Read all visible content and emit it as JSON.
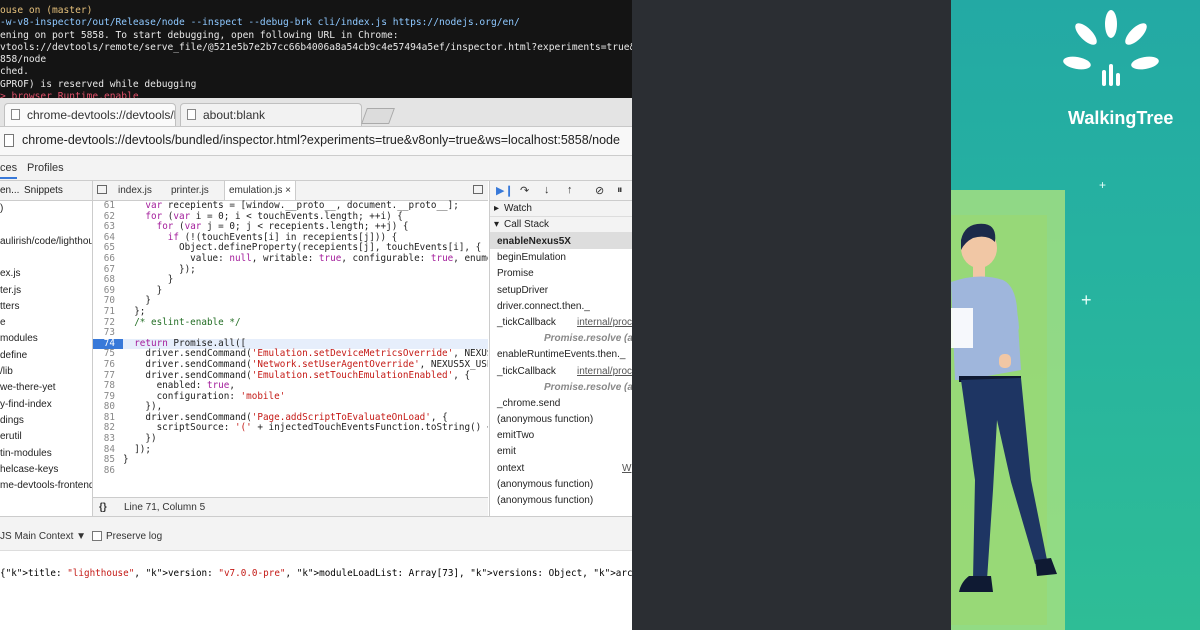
{
  "terminal": {
    "lines": [
      {
        "text": "ouse on (master)",
        "tone": "yellow"
      },
      {
        "text": "-w-v8-inspector/out/Release/node --inspect --debug-brk cli/index.js https://nodejs.org/en/",
        "tone": "cyan"
      },
      {
        "text": "ening on port 5858. To start debugging, open following URL in Chrome:",
        "tone": "plain"
      },
      {
        "text": "vtools://devtools/remote/serve_file/@521e5b7e2b7cc66b4006a8a54cb9c4e57494a5ef/inspector.html?experiments=true&",
        "tone": "plain"
      },
      {
        "text": "858/node",
        "tone": "plain"
      },
      {
        "text": "ched.",
        "tone": "plain"
      },
      {
        "text": "GPROF) is reserved while debugging",
        "tone": "plain"
      },
      {
        "text": "> browser Runtime.enable",
        "tone": "red"
      }
    ]
  },
  "browser": {
    "tabs": [
      {
        "label": "chrome-devtools://devtools/bu"
      },
      {
        "label": "about:blank"
      }
    ],
    "url": "chrome-devtools://devtools/bundled/inspector.html?experiments=true&v8only=true&ws=localhost:5858/node"
  },
  "devtools": {
    "panel_tabs": [
      "ces",
      "Profiles"
    ],
    "navigator_tabs": [
      "en...",
      "Snippets"
    ],
    "navigator_items": [
      ")",
      "",
      "aulirish/code/lighthous",
      "",
      "ex.js",
      "ter.js",
      "tters",
      "e",
      "modules",
      "define",
      "/lib",
      "we-there-yet",
      "y-find-index",
      "dings",
      "erutil",
      "tin-modules",
      "helcase-keys",
      "me-devtools-frontend"
    ],
    "file_tabs": [
      "index.js",
      "printer.js",
      "emulation.js ×"
    ],
    "code": [
      {
        "n": "61",
        "text": "    var recepients = [window.__proto__, document.__proto__];"
      },
      {
        "n": "62",
        "text": "    for (var i = 0; i < touchEvents.length; ++i) {"
      },
      {
        "n": "63",
        "text": "      for (var j = 0; j < recepients.length; ++j) {"
      },
      {
        "n": "64",
        "text": "        if (!(touchEvents[i] in recepients[j])) {"
      },
      {
        "n": "65",
        "text": "          Object.defineProperty(recepients[j], touchEvents[i], {"
      },
      {
        "n": "66",
        "text": "            value: null, writable: true, configurable: true, enumera"
      },
      {
        "n": "67",
        "text": "          });"
      },
      {
        "n": "68",
        "text": "        }"
      },
      {
        "n": "69",
        "text": "      }"
      },
      {
        "n": "70",
        "text": "    }"
      },
      {
        "n": "71",
        "text": "  };"
      },
      {
        "n": "72",
        "text": "  /* eslint-enable */"
      },
      {
        "n": "73",
        "text": ""
      },
      {
        "n": "74",
        "text": "  return Promise.all(["
      },
      {
        "n": "75",
        "text": "    driver.sendCommand('Emulation.setDeviceMetricsOverride', NEXUS5X"
      },
      {
        "n": "76",
        "text": "    driver.sendCommand('Network.setUserAgentOverride', NEXUS5X_USERA"
      },
      {
        "n": "77",
        "text": "    driver.sendCommand('Emulation.setTouchEmulationEnabled', {"
      },
      {
        "n": "78",
        "text": "      enabled: true,"
      },
      {
        "n": "79",
        "text": "      configuration: 'mobile'"
      },
      {
        "n": "80",
        "text": "    }),"
      },
      {
        "n": "81",
        "text": "    driver.sendCommand('Page.addScriptToEvaluateOnLoad', {"
      },
      {
        "n": "82",
        "text": "      scriptSource: '(' + injectedTouchEventsFunction.toString() + '"
      },
      {
        "n": "83",
        "text": "    })"
      },
      {
        "n": "84",
        "text": "  ]);"
      },
      {
        "n": "85",
        "text": "}"
      },
      {
        "n": "86",
        "text": ""
      }
    ],
    "breakpoint_line": "74",
    "status_text": "Line 71, Column 5",
    "status_braces": "{}",
    "watch_label": "Watch",
    "call_stack_label": "Call Stack",
    "call_stack": [
      {
        "fn": "enableNexus5X",
        "loc": "",
        "kind": "selected"
      },
      {
        "fn": "beginEmulation",
        "loc": "",
        "kind": "frame"
      },
      {
        "fn": "Promise",
        "loc": "",
        "kind": "frame"
      },
      {
        "fn": "setupDriver",
        "loc": "",
        "kind": "frame"
      },
      {
        "fn": "driver.connect.then._",
        "loc": "",
        "kind": "frame"
      },
      {
        "fn": "_tickCallback",
        "loc": "internal/proce",
        "kind": "frame"
      },
      {
        "fn": "Promise.resolve (as",
        "loc": "",
        "kind": "async"
      },
      {
        "fn": "enableRuntimeEvents.then._",
        "loc": "",
        "kind": "frame"
      },
      {
        "fn": "_tickCallback",
        "loc": "internal/process",
        "kind": "frame"
      },
      {
        "fn": "Promise.resolve (as",
        "loc": "",
        "kind": "async"
      },
      {
        "fn": "_chrome.send",
        "loc": "",
        "kind": "frame"
      },
      {
        "fn": "(anonymous function)",
        "loc": "",
        "kind": "frame"
      },
      {
        "fn": "emitTwo",
        "loc": "",
        "kind": "frame"
      },
      {
        "fn": "emit",
        "loc": "",
        "kind": "frame"
      },
      {
        "fn": "ontext",
        "loc": "W",
        "kind": "frame"
      },
      {
        "fn": "(anonymous function)",
        "loc": "",
        "kind": "frame"
      },
      {
        "fn": "(anonymous function)",
        "loc": "",
        "kind": "frame"
      }
    ],
    "console_context": "JS Main Context ▼",
    "preserve_log": "Preserve log",
    "console_output": "{title: \"lighthouse\", version: \"v7.0.0-pre\", moduleLoadList: Array[73], versions: Object, arch: \"x64\"…}"
  },
  "brand": {
    "name": "WalkingTree"
  },
  "colors": {
    "teal": "#23a9a4",
    "green": "#b4e67e",
    "dark": "#2b2e33",
    "accent_blue": "#3879d9"
  }
}
